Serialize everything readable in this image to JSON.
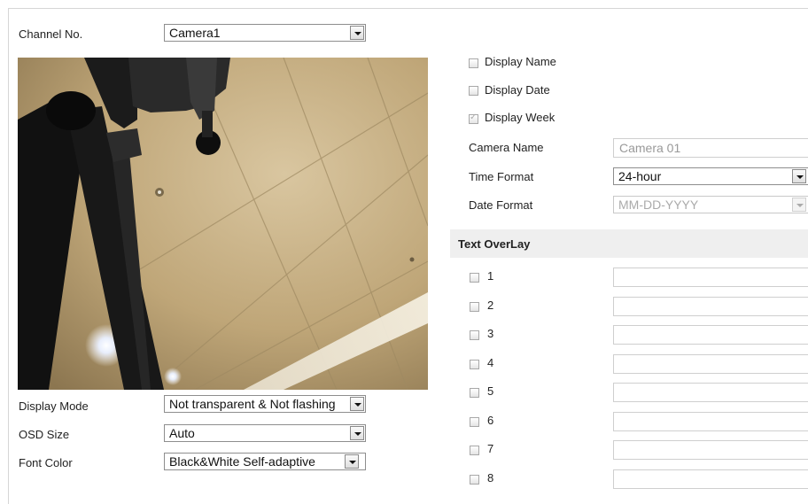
{
  "channel": {
    "label": "Channel No.",
    "value": "Camera1"
  },
  "display": {
    "name": {
      "label": "Display Name",
      "checked": false
    },
    "date": {
      "label": "Display Date",
      "checked": false
    },
    "week": {
      "label": "Display Week",
      "checked": true,
      "disabled": true
    }
  },
  "camera_name": {
    "label": "Camera Name",
    "placeholder": "Camera 01"
  },
  "time_format": {
    "label": "Time Format",
    "value": "24-hour"
  },
  "date_format": {
    "label": "Date Format",
    "value": "MM-DD-YYYY"
  },
  "text_overlay": {
    "title": "Text OverLay",
    "items": [
      {
        "num": "1",
        "value": ""
      },
      {
        "num": "2",
        "value": ""
      },
      {
        "num": "3",
        "value": ""
      },
      {
        "num": "4",
        "value": ""
      },
      {
        "num": "5",
        "value": ""
      },
      {
        "num": "6",
        "value": ""
      },
      {
        "num": "7",
        "value": ""
      },
      {
        "num": "8",
        "value": ""
      }
    ]
  },
  "display_mode": {
    "label": "Display Mode",
    "value": "Not transparent & Not flashing"
  },
  "osd_size": {
    "label": "OSD Size",
    "value": "Auto"
  },
  "font_color": {
    "label": "Font Color",
    "value": "Black&White Self-adaptive"
  }
}
